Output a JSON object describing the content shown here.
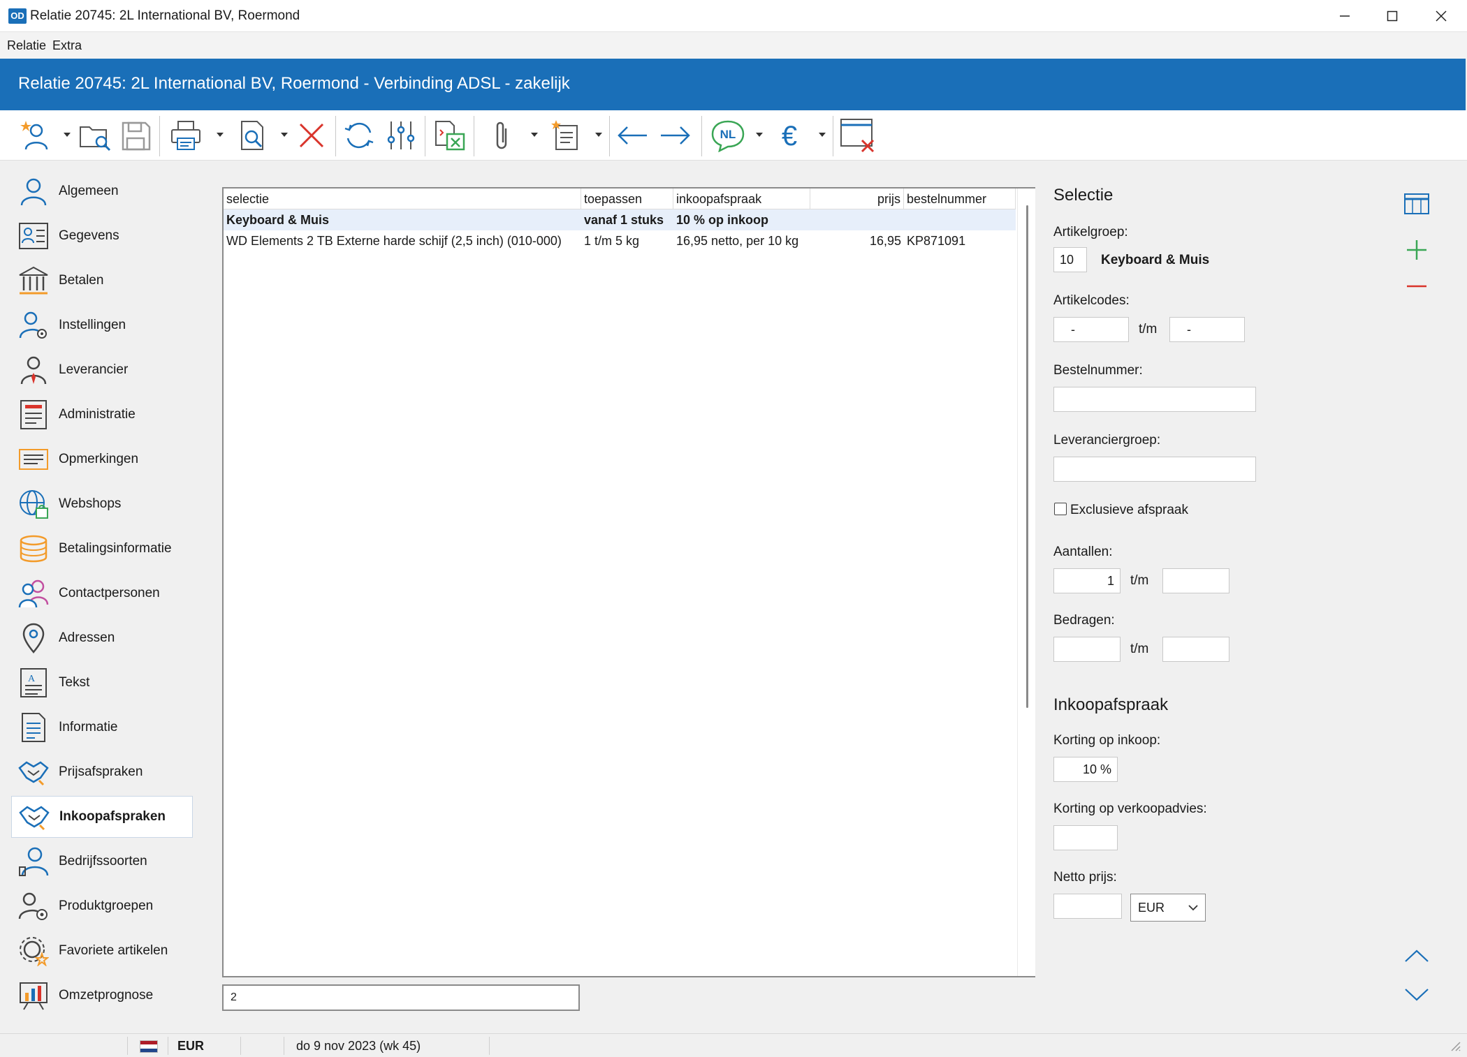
{
  "window": {
    "title": "Relatie 20745: 2L International BV, Roermond",
    "logo_text": "OD"
  },
  "menu": [
    "Relatie",
    "Extra"
  ],
  "banner": {
    "title": "Relatie 20745: 2L International BV, Roermond - Verbinding ADSL - zakelijk"
  },
  "toolbar": {
    "icons": [
      "new-relation-icon",
      "open-folder-search-icon",
      "save-icon",
      "print-icon",
      "print-preview-icon",
      "delete-icon",
      "refresh-icon",
      "sliders-icon",
      "export-excel-icon",
      "attachment-icon",
      "new-document-icon",
      "arrow-left-icon",
      "arrow-right-icon",
      "language-nl-icon",
      "currency-euro-icon",
      "close-window-icon"
    ],
    "language_label": "NL",
    "currency_symbol": "€"
  },
  "sidebar": {
    "items": [
      {
        "label": "Algemeen",
        "icon": "user-icon"
      },
      {
        "label": "Gegevens",
        "icon": "id-card-icon"
      },
      {
        "label": "Betalen",
        "icon": "bank-icon"
      },
      {
        "label": "Instellingen",
        "icon": "user-settings-icon"
      },
      {
        "label": "Leverancier",
        "icon": "supplier-icon"
      },
      {
        "label": "Administratie",
        "icon": "administration-icon"
      },
      {
        "label": "Opmerkingen",
        "icon": "notes-icon"
      },
      {
        "label": "Webshops",
        "icon": "webshop-globe-icon"
      },
      {
        "label": "Betalingsinformatie",
        "icon": "coins-icon"
      },
      {
        "label": "Contactpersonen",
        "icon": "contacts-icon"
      },
      {
        "label": "Adressen",
        "icon": "map-pin-icon"
      },
      {
        "label": "Tekst",
        "icon": "text-document-icon"
      },
      {
        "label": "Informatie",
        "icon": "info-document-icon"
      },
      {
        "label": "Prijsafspraken",
        "icon": "handshake-icon"
      },
      {
        "label": "Inkoopafspraken",
        "icon": "handshake-icon"
      },
      {
        "label": "Bedrijfssoorten",
        "icon": "company-type-icon"
      },
      {
        "label": "Produktgroepen",
        "icon": "product-groups-icon"
      },
      {
        "label": "Favoriete artikelen",
        "icon": "favorite-gear-icon"
      },
      {
        "label": "Omzetprognose",
        "icon": "chart-board-icon"
      }
    ],
    "active": "Inkoopafspraken"
  },
  "grid": {
    "columns": [
      "selectie",
      "toepassen",
      "inkoopafspraak",
      "prijs",
      "bestelnummer"
    ],
    "rows": [
      {
        "selectie": "Keyboard & Muis",
        "toepassen": "vanaf 1 stuks",
        "inkoopafspraak": "10 % op inkoop",
        "prijs": "",
        "bestelnummer": ""
      },
      {
        "selectie": "WD Elements 2 TB Externe harde schijf (2,5 inch) (010-000)",
        "toepassen": "1 t/m 5 kg",
        "inkoopafspraak": "16,95 netto, per 10 kg",
        "prijs": "16,95",
        "bestelnummer": "KP871091"
      }
    ]
  },
  "filter_value": "2",
  "form": {
    "selectie_header": "Selectie",
    "artikelgroep_label": "Artikelgroep:",
    "artikelgroep_code": "10",
    "artikelgroep_name": "Keyboard & Muis",
    "artikelcodes_label": "Artikelcodes:",
    "artikelcodes_from": "-",
    "artikelcodes_to": "-",
    "tm": "t/m",
    "bestelnummer_label": "Bestelnummer:",
    "bestelnummer_value": "",
    "leveranciergroep_label": "Leveranciergroep:",
    "leveranciergroep_value": "",
    "exclusive_label": "Exclusieve afspraak",
    "aantallen_label": "Aantallen:",
    "aantallen_from": "1",
    "aantallen_to": "",
    "bedragen_label": "Bedragen:",
    "bedragen_from": "",
    "bedragen_to": "",
    "inkoop_header": "Inkoopafspraak",
    "korting_inkoop_label": "Korting op inkoop:",
    "korting_inkoop_value": "10 %",
    "korting_verkoop_label": "Korting op verkoopadvies:",
    "korting_verkoop_value": "",
    "netto_label": "Netto prijs:",
    "netto_value": "",
    "currency_value": "EUR"
  },
  "statusbar": {
    "currency": "EUR",
    "date": "do 9 nov 2023 (wk 45)"
  },
  "colors": {
    "brand_blue": "#1a6fb8",
    "add_green": "#3aa655",
    "remove_red": "#d9342b"
  }
}
